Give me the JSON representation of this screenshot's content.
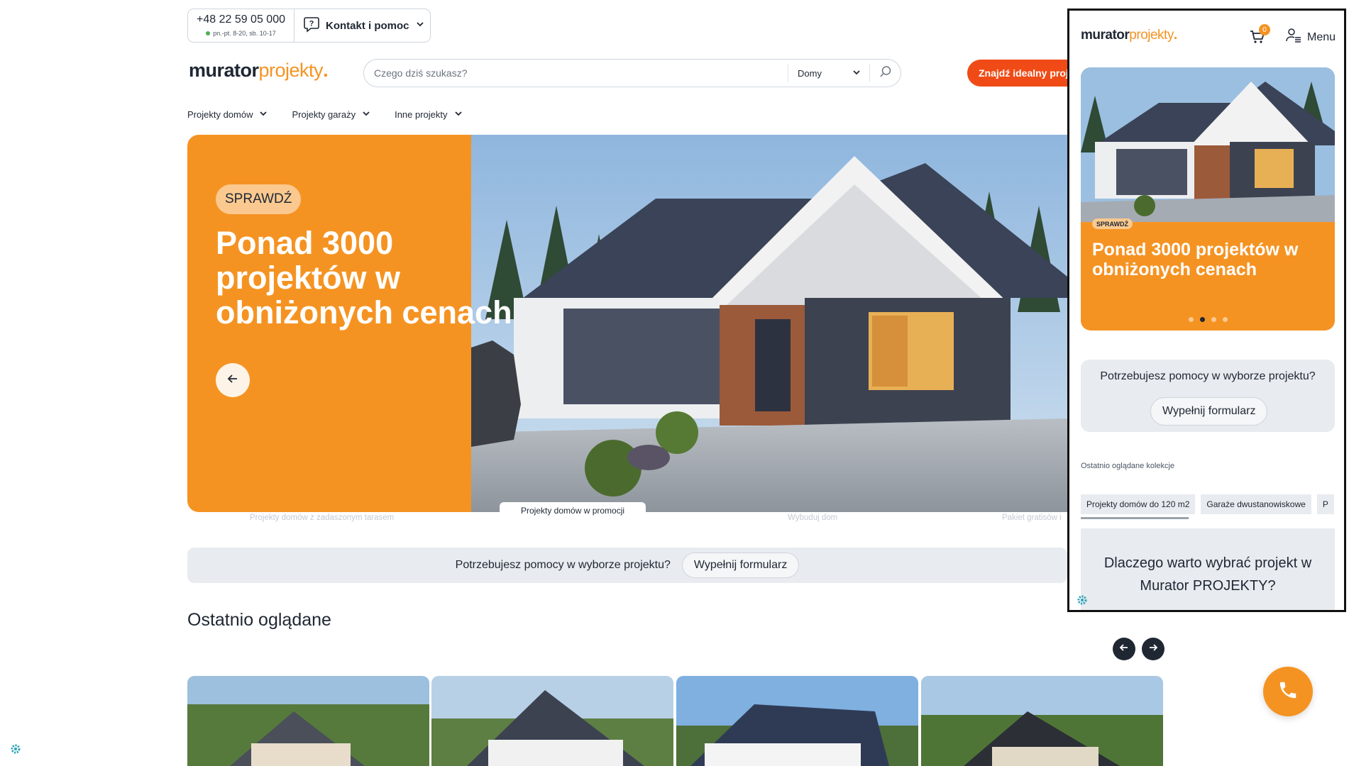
{
  "contact": {
    "phone": "+48 22 59 05 000",
    "hours": "pn.-pt. 8-20, sb. 10-17",
    "help_label": "Kontakt i pomoc"
  },
  "logo": {
    "part1": "murator",
    "part2": "projekty",
    "dot": "."
  },
  "search": {
    "placeholder": "Czego dziś szukasz?",
    "category": "Domy"
  },
  "cta_label": "Znajdź idealny proj",
  "nav": [
    {
      "label": "Projekty domów"
    },
    {
      "label": "Projekty garaży"
    },
    {
      "label": "Inne projekty"
    }
  ],
  "hero": {
    "badge": "SPRAWDŹ",
    "title": "Ponad 3000 projektów w obniżonych cenach",
    "tabs": [
      "Projekty domów z zadaszonym tarasem",
      "Projekty domów w promocji",
      "Wybuduj dom",
      "Pakiet gratisów i"
    ]
  },
  "helpbar": {
    "question": "Potrzebujesz pomocy w wyborze projektu?",
    "button": "Wypełnij formularz"
  },
  "recent": {
    "title": "Ostatnio oglądane"
  },
  "mobile": {
    "cart_count": "0",
    "menu_label": "Menu",
    "badge": "SPRAWDŹ",
    "title": "Ponad 3000 projektów w obniżonych cenach",
    "help_question": "Potrzebujesz pomocy w wyborze projektu?",
    "help_button": "Wypełnij formularz",
    "recent_label": "Ostatnio oglądane kolekcje",
    "chips": [
      "Projekty domów do 120 m2",
      "Garaże dwustanowiskowe",
      "P"
    ],
    "why_title": "Dlaczego warto wybrać projekt w Murator PROJEKTY?"
  },
  "colors": {
    "accent_orange": "#f59322",
    "cta_red": "#f04b16",
    "dark": "#1f2733",
    "light_gray": "#e8ebef"
  },
  "icons": [
    "help-bubble-icon",
    "chevron-down-icon",
    "search-icon",
    "arrow-left-icon",
    "arrow-right-icon",
    "phone-icon",
    "cart-icon",
    "user-menu-icon",
    "gear-icon"
  ]
}
